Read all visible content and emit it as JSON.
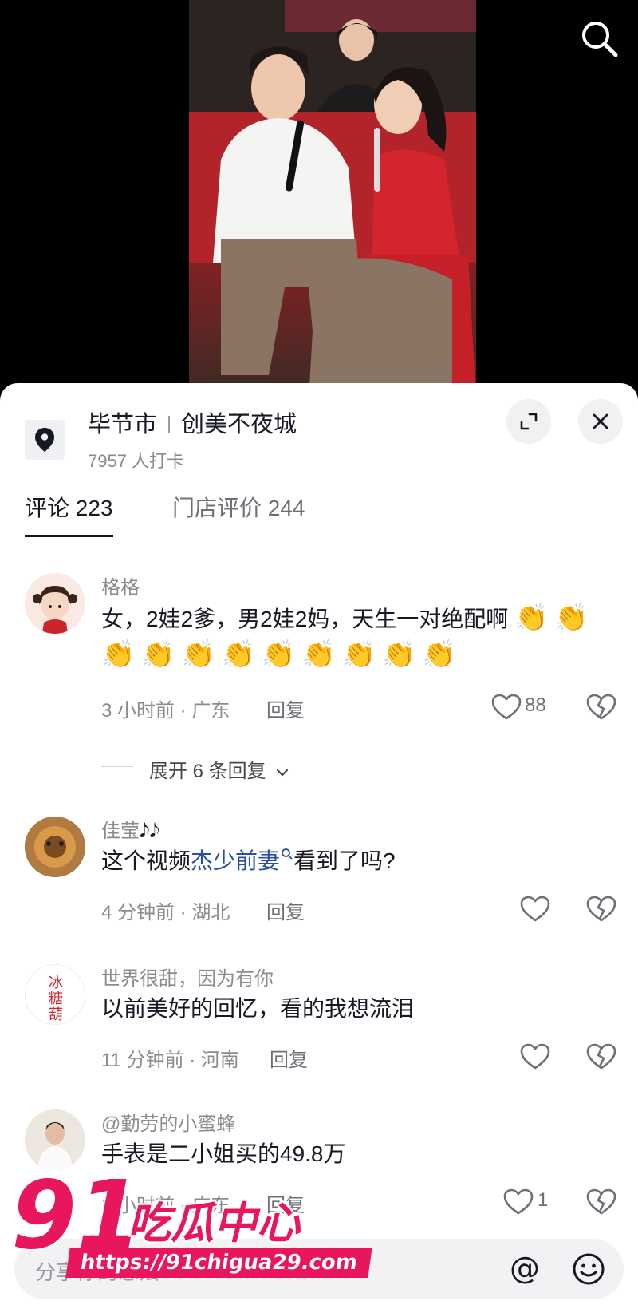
{
  "location": {
    "city": "毕节市",
    "place": "创美不夜城",
    "checkins": "7957 人打卡"
  },
  "tabs": {
    "comments": "评论 223",
    "reviews": "门店评价 244"
  },
  "comments": [
    {
      "user": "格格",
      "text": "女，2娃2爹，男2娃2妈，天生一对绝配啊",
      "clap_count": 11,
      "meta": "3 小时前 · 广东",
      "reply": "回复",
      "likes": "88",
      "expand": "展开 6 条回复"
    },
    {
      "user": "佳莹",
      "user_suffix": "𝅘𝅥𝅮𝅘𝅥𝅮",
      "text_before": "这个视频",
      "text_link": "杰少前妻",
      "text_after": "看到了吗?",
      "meta": "4 分钟前 · 湖北",
      "reply": "回复"
    },
    {
      "user": "世界很甜，因为有你",
      "text": "以前美好的回忆，看的我想流泪",
      "meta": "11 分钟前 · 河南",
      "reply": "回复"
    },
    {
      "user": "@勤劳的小蜜蜂",
      "text": "手表是二小姐买的49.8万",
      "meta": "1 小时前 · 广东",
      "reply": "回复",
      "likes": "1"
    }
  ],
  "input": {
    "placeholder": "分享你的想法"
  },
  "watermark": {
    "brand_number": "91",
    "brand_text": "吃瓜中心",
    "url": "https://91chigua29.com"
  },
  "colors": {
    "link": "#2a4fa1",
    "watermark": "#e8175d"
  }
}
